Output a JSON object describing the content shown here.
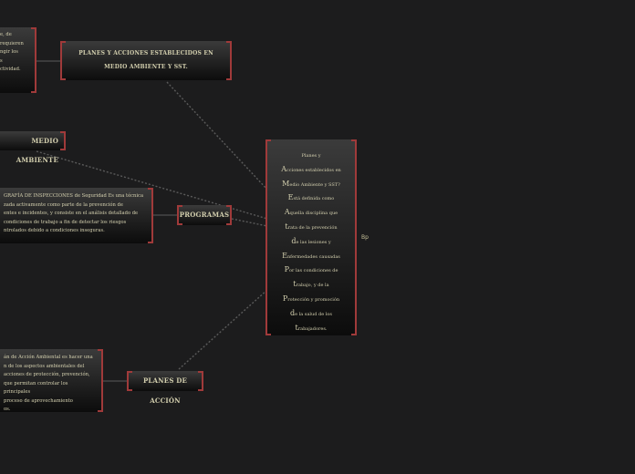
{
  "central": {
    "lines": [
      {
        "cap": "",
        "text": "Planes y"
      },
      {
        "cap": "A",
        "text": "cciones establecidos en"
      },
      {
        "cap": "M",
        "text": "edio Ambiente y SST?"
      },
      {
        "cap": "E",
        "text": "stá definida como"
      },
      {
        "cap": "A",
        "text": "quella disciplina que"
      },
      {
        "cap": "t",
        "text": "rata de la prevención"
      },
      {
        "cap": "d",
        "text": "e las lesiones y"
      },
      {
        "cap": "E",
        "text": "nfermedades causadas"
      },
      {
        "cap": "P",
        "text": "or las condiciones de"
      },
      {
        "cap": "t",
        "text": "rabajo, y de la"
      },
      {
        "cap": "P",
        "text": "rotección y promoción"
      },
      {
        "cap": "d",
        "text": "e la salud de los"
      },
      {
        "cap": "t",
        "text": "rabajadores."
      }
    ],
    "side_tag": "Bp"
  },
  "planes_acciones": {
    "label": "PLANES Y ACCIONES ESTABLECIDOS EN MEDIO AMBIENTE Y SST."
  },
  "medio_ambiente": {
    "label": "MEDIO AMBIENTE"
  },
  "programas": {
    "label": "PROGRAMAS"
  },
  "planes_accion": {
    "label": "PLANES DE ACCIÓN"
  },
  "top_left_text": {
    "lines": [
      "e, de",
      "requieren",
      "ngir los",
      "s",
      "ctividad."
    ]
  },
  "programas_text": {
    "lines": [
      "GRAFÍA DE INSPECCIONES de Seguridad Es una técnica",
      "zada activamente como parte de la prevención de",
      "entes e incidentes, y consiste en el análisis detallado de",
      "condiciones de trabajo a fin de detectar los riesgos",
      "ntrolados debido a condiciones inseguras."
    ]
  },
  "plan_accion_text": {
    "lines": [
      "án de Acción Ambiental es hacer una",
      "n de los aspectos ambientales del",
      "acciones de protección, prevención,",
      "que permitan controlar los principales",
      "proceso de aprovechamiento",
      "os."
    ]
  }
}
